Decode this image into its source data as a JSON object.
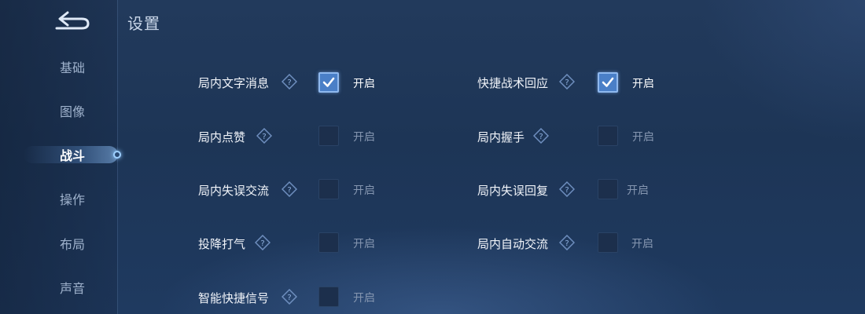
{
  "header": {
    "title": "设置"
  },
  "sidebar": {
    "items": [
      {
        "label": "基础",
        "active": false
      },
      {
        "label": "图像",
        "active": false
      },
      {
        "label": "战斗",
        "active": true
      },
      {
        "label": "操作",
        "active": false
      },
      {
        "label": "布局",
        "active": false
      },
      {
        "label": "声音",
        "active": false
      }
    ]
  },
  "settings": {
    "left": [
      {
        "label": "局内文字消息",
        "checked": true,
        "option": "开启"
      },
      {
        "label": "局内点赞",
        "checked": false,
        "option": "开启"
      },
      {
        "label": "局内失误交流",
        "checked": false,
        "option": "开启"
      },
      {
        "label": "投降打气",
        "checked": false,
        "option": "开启"
      },
      {
        "label": "智能快捷信号",
        "checked": false,
        "option": "开启"
      }
    ],
    "right": [
      {
        "label": "快捷战术回应",
        "checked": true,
        "option": "开启"
      },
      {
        "label": "局内握手",
        "checked": false,
        "option": "开启"
      },
      {
        "label": "局内失误回复",
        "checked": false,
        "option": "开启"
      },
      {
        "label": "局内自动交流",
        "checked": false,
        "option": "开启"
      }
    ]
  },
  "icons": {
    "back": "back-arrow-icon",
    "help": "question-diamond-icon",
    "check": "checkmark-icon"
  },
  "colors": {
    "accent": "#4a7fc7",
    "background": "#1f3658"
  }
}
